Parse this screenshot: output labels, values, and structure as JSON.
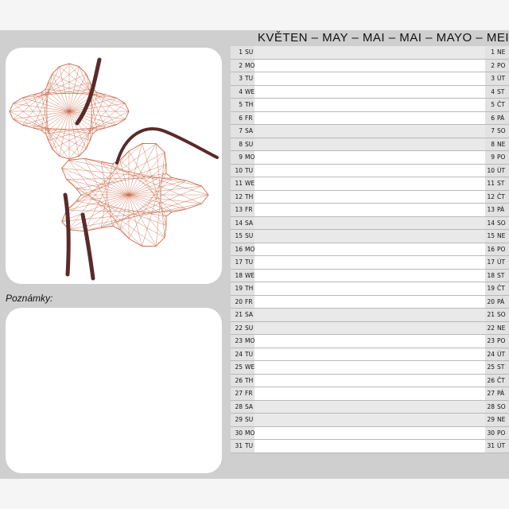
{
  "header": {
    "title": "KVĚTEN – MAY – MAI – MAI – MAYO – MEI"
  },
  "notes": {
    "label": "Poznámky:"
  },
  "colors": {
    "sheet": "#cfcfcf",
    "flower_thread": "#c96a4a",
    "stem": "#5a2a2a"
  },
  "days": [
    {
      "n": "1",
      "en": "SU",
      "cz": "NE"
    },
    {
      "n": "2",
      "en": "MO",
      "cz": "PO"
    },
    {
      "n": "3",
      "en": "TU",
      "cz": "ÚT"
    },
    {
      "n": "4",
      "en": "WE",
      "cz": "ST"
    },
    {
      "n": "5",
      "en": "TH",
      "cz": "ČT"
    },
    {
      "n": "6",
      "en": "FR",
      "cz": "PÁ"
    },
    {
      "n": "7",
      "en": "SA",
      "cz": "SO"
    },
    {
      "n": "8",
      "en": "SU",
      "cz": "NE"
    },
    {
      "n": "9",
      "en": "MO",
      "cz": "PO"
    },
    {
      "n": "10",
      "en": "TU",
      "cz": "ÚT"
    },
    {
      "n": "11",
      "en": "WE",
      "cz": "ST"
    },
    {
      "n": "12",
      "en": "TH",
      "cz": "ČT"
    },
    {
      "n": "13",
      "en": "FR",
      "cz": "PÁ"
    },
    {
      "n": "14",
      "en": "SA",
      "cz": "SO"
    },
    {
      "n": "15",
      "en": "SU",
      "cz": "NE"
    },
    {
      "n": "16",
      "en": "MO",
      "cz": "PO"
    },
    {
      "n": "17",
      "en": "TU",
      "cz": "ÚT"
    },
    {
      "n": "18",
      "en": "WE",
      "cz": "ST"
    },
    {
      "n": "19",
      "en": "TH",
      "cz": "ČT"
    },
    {
      "n": "20",
      "en": "FR",
      "cz": "PÁ"
    },
    {
      "n": "21",
      "en": "SA",
      "cz": "SO"
    },
    {
      "n": "22",
      "en": "SU",
      "cz": "NE"
    },
    {
      "n": "23",
      "en": "MO",
      "cz": "PO"
    },
    {
      "n": "24",
      "en": "TU",
      "cz": "ÚT"
    },
    {
      "n": "25",
      "en": "WE",
      "cz": "ST"
    },
    {
      "n": "26",
      "en": "TH",
      "cz": "ČT"
    },
    {
      "n": "27",
      "en": "FR",
      "cz": "PÁ"
    },
    {
      "n": "28",
      "en": "SA",
      "cz": "SO"
    },
    {
      "n": "29",
      "en": "SU",
      "cz": "NE"
    },
    {
      "n": "30",
      "en": "MO",
      "cz": "PO"
    },
    {
      "n": "31",
      "en": "TU",
      "cz": "ÚT"
    }
  ]
}
